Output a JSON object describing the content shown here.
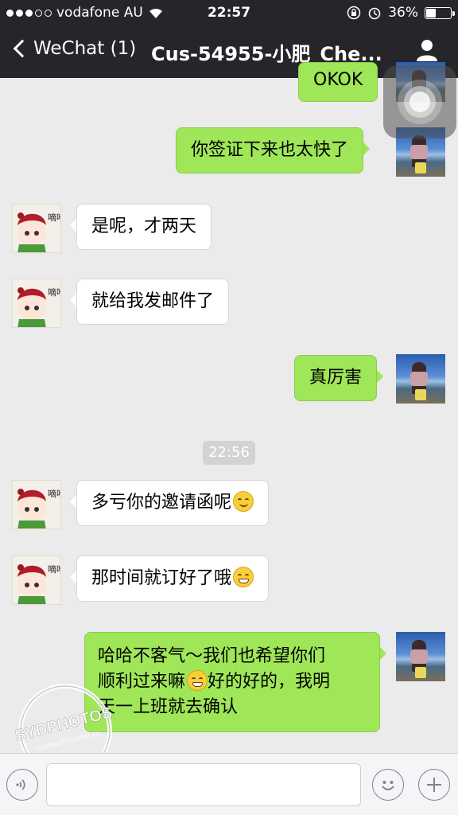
{
  "status_bar": {
    "carrier": "vodafone AU",
    "time": "22:57",
    "battery": "36%",
    "battery_level": 0.36
  },
  "nav": {
    "back_label": "WeChat (1)",
    "title": "Cus-54955-小肥_Che..."
  },
  "messages": [
    {
      "side": "right",
      "text": "OKOK"
    },
    {
      "side": "right",
      "text": "你签证下来也太快了"
    },
    {
      "side": "left",
      "text": "是呢，才两天"
    },
    {
      "side": "left",
      "text": "就给我发邮件了"
    },
    {
      "side": "right",
      "text": "真厉害"
    },
    {
      "side": "left",
      "text": "多亏你的邀请函呢",
      "emoji": "smile-emoji"
    },
    {
      "side": "left",
      "text": "那时间就订好了哦",
      "emoji": "grin-emoji"
    },
    {
      "side": "right",
      "text_line1": "哈哈不客气～我们也希望你们",
      "text_line2a": "顺利过来嘛",
      "text_line2b": "好的好的，我明",
      "text_line3": "天一上班就去确认",
      "emoji": "grin-emoji"
    }
  ],
  "timestamp": "22:56",
  "friend_avatar_text": "嘀哈呀?",
  "watermark": {
    "main": "SYDPHOTOS",
    "sub": "SYDPHOTOS.COM.AU"
  },
  "input_bar": {
    "placeholder": ""
  }
}
